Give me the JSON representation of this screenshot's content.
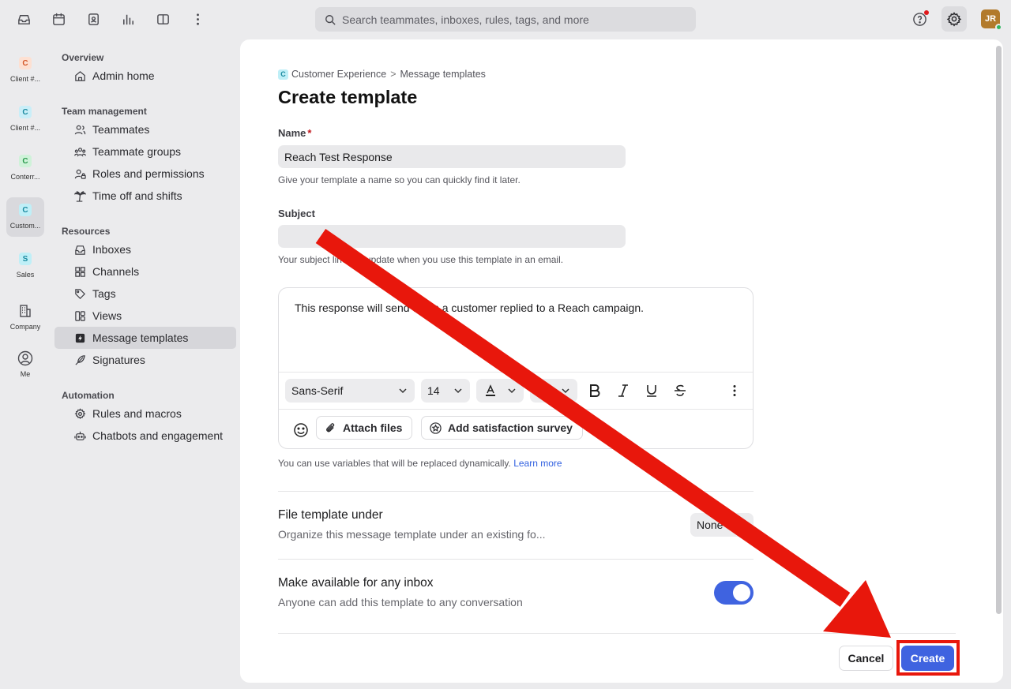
{
  "topbar": {
    "search_placeholder": "Search teammates, inboxes, rules, tags, and more",
    "avatar_initials": "JR"
  },
  "rail": [
    {
      "badge": "C",
      "label": "Client #...",
      "badge_bg": "#fde0d2",
      "badge_fg": "#d4582a"
    },
    {
      "badge": "C",
      "label": "Client #...",
      "badge_bg": "#c9eef8",
      "badge_fg": "#1a8aa0"
    },
    {
      "badge": "C",
      "label": "Conterr...",
      "badge_bg": "#cff2d9",
      "badge_fg": "#2a9a4c"
    },
    {
      "badge": "C",
      "label": "Custom...",
      "badge_bg": "#bfeff7",
      "badge_fg": "#1a8aa0"
    },
    {
      "badge": "S",
      "label": "Sales",
      "badge_bg": "#bfeff7",
      "badge_fg": "#1a8aa0"
    },
    {
      "label": "Company"
    },
    {
      "label": "Me"
    }
  ],
  "nav": {
    "overview": "Overview",
    "admin_home": "Admin home",
    "team_management": "Team management",
    "teammates": "Teammates",
    "teammate_groups": "Teammate groups",
    "roles": "Roles and permissions",
    "time_off": "Time off and shifts",
    "resources": "Resources",
    "inboxes": "Inboxes",
    "channels": "Channels",
    "tags": "Tags",
    "views": "Views",
    "message_templates": "Message templates",
    "signatures": "Signatures",
    "automation": "Automation",
    "rules": "Rules and macros",
    "chatbots": "Chatbots and engagement"
  },
  "breadcrumb": {
    "badge": "C",
    "parent": "Customer Experience",
    "separator": ">",
    "current": "Message templates"
  },
  "page_title": "Create template",
  "form": {
    "name_label": "Name",
    "name_required": "*",
    "name_value": "Reach Test Response",
    "name_hint": "Give your template a name so you can quickly find it later.",
    "subject_label": "Subject",
    "subject_value": "",
    "subject_hint": "Your subject line will update when you use this template in an email.",
    "body": "This response will send when a customer replied to a Reach campaign.",
    "font_family": "Sans-Serif",
    "font_size": "14",
    "attach_files": "Attach files",
    "add_survey": "Add satisfaction survey",
    "variables_hint": "You can use variables that will be replaced dynamically.",
    "learn_more": "Learn more",
    "file_under_title": "File template under",
    "file_under_desc": "Organize this message template under an existing fo...",
    "folder_value": "None",
    "inbox_title": "Make available for any inbox",
    "inbox_desc": "Anyone can add this template to any conversation",
    "inbox_toggle_on": true
  },
  "actions": {
    "cancel": "Cancel",
    "create": "Create"
  },
  "colors": {
    "accent": "#3f63e0",
    "annotation": "#e8170c"
  }
}
